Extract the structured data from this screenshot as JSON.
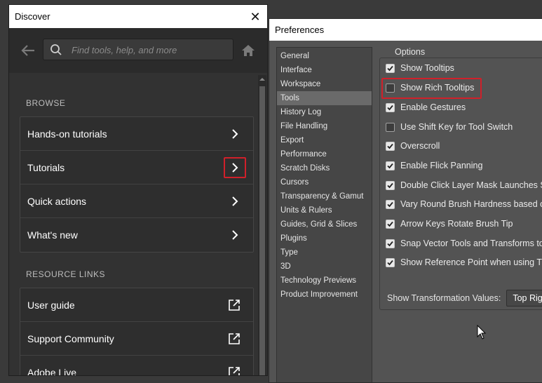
{
  "discover": {
    "title": "Discover",
    "search_placeholder": "Find tools, help, and more",
    "browse_label": "BROWSE",
    "browse_items": [
      {
        "label": "Hands-on tutorials"
      },
      {
        "label": "Tutorials"
      },
      {
        "label": "Quick actions"
      },
      {
        "label": "What's new"
      }
    ],
    "resource_label": "RESOURCE LINKS",
    "resource_items": [
      {
        "label": "User guide"
      },
      {
        "label": "Support Community"
      },
      {
        "label": "Adobe Live"
      }
    ]
  },
  "preferences": {
    "title": "Preferences",
    "categories": [
      "General",
      "Interface",
      "Workspace",
      "Tools",
      "History Log",
      "File Handling",
      "Export",
      "Performance",
      "Scratch Disks",
      "Cursors",
      "Transparency & Gamut",
      "Units & Rulers",
      "Guides, Grid & Slices",
      "Plugins",
      "Type",
      "3D",
      "Technology Previews",
      "Product Improvement"
    ],
    "selected_category": "Tools",
    "options_title": "Options",
    "options": [
      {
        "label": "Show Tooltips",
        "checked": true
      },
      {
        "label": "Show Rich Tooltips",
        "checked": false
      },
      {
        "label": "Enable Gestures",
        "checked": true
      },
      {
        "label": "Use Shift Key for Tool Switch",
        "checked": false
      },
      {
        "label": "Overscroll",
        "checked": true
      },
      {
        "label": "Enable Flick Panning",
        "checked": true
      },
      {
        "label": "Double Click Layer Mask Launches Se",
        "checked": true
      },
      {
        "label": "Vary Round Brush Hardness based or",
        "checked": true
      },
      {
        "label": "Arrow Keys Rotate Brush Tip",
        "checked": true
      },
      {
        "label": "Snap Vector Tools and Transforms to",
        "checked": true
      },
      {
        "label": "Show Reference Point when using Tr",
        "checked": true
      }
    ],
    "transform_label": "Show Transformation Values:",
    "transform_value": "Top Rig"
  },
  "colors": {
    "highlight": "#d0202a",
    "panel_dark": "#323232",
    "panel_prefs": "#535353"
  }
}
